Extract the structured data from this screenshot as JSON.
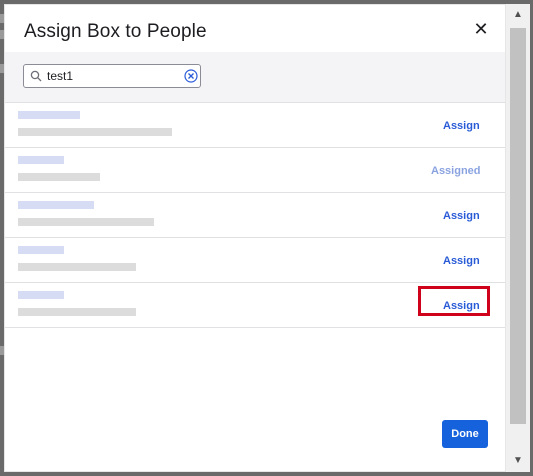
{
  "dialog": {
    "title": "Assign Box to People",
    "close_glyph": "✕",
    "search_value": "test1",
    "done_label": "Done"
  },
  "rows": [
    {
      "action": "Assign",
      "state": "assign"
    },
    {
      "action": "Assigned",
      "state": "assigned"
    },
    {
      "action": "Assign",
      "state": "assign"
    },
    {
      "action": "Assign",
      "state": "assign"
    },
    {
      "action": "Assign",
      "state": "assign"
    }
  ],
  "icons": {
    "search": "search-icon",
    "clear": "clear-icon",
    "close": "close-icon",
    "scroll_up": "scroll-up-arrow-icon",
    "scroll_down": "scroll-down-arrow-icon"
  },
  "colors": {
    "accent": "#1662dd",
    "link": "#2a5bd7",
    "assigned": "#8aa3e0",
    "highlight": "#d0021b"
  }
}
